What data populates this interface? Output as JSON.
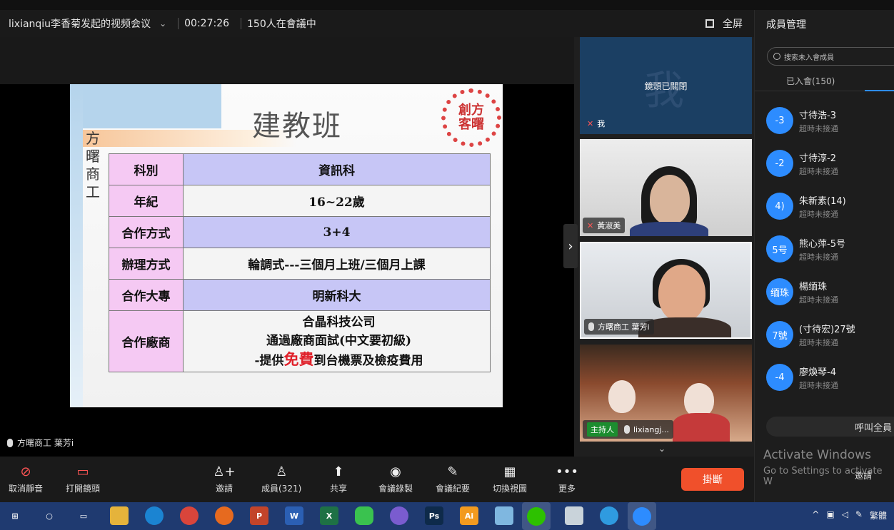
{
  "meeting": {
    "title": "lixianqiu李香菊发起的视频会议",
    "elapsed": "00:27:26",
    "participants_in_meeting": "150人在會議中",
    "fullscreen_label": "全屏"
  },
  "slide": {
    "heading": "建教班",
    "school_vertical": "方曙商工",
    "seal_text": "創方客曙",
    "table": [
      {
        "key": "科別",
        "value": "資訊科"
      },
      {
        "key": "年紀",
        "value": "16~22歲"
      },
      {
        "key": "合作方式",
        "value": "3+4"
      },
      {
        "key": "辦理方式",
        "value": "輪調式---三個月上班/三個月上課"
      },
      {
        "key": "合作大專",
        "value": "明新科大"
      }
    ],
    "vendor": {
      "key": "合作廠商",
      "line1": "合晶科技公司",
      "line2": "通過廠商面試(中文要初級)",
      "line3_pre": "-提供",
      "line3_red": "免費",
      "line3_post": "到台機票及檢疫費用"
    }
  },
  "active_speaker": "方曙商工 葉芳i",
  "tiles": {
    "me_big": "我",
    "me_camera_off": "鏡頭已關閉",
    "me_label": "我",
    "p1_label": "黃淑美",
    "p2_label": "方曙商工 葉芳i",
    "p3_host": "主持人",
    "p3_label": "lixiangj..."
  },
  "panel": {
    "title": "成員管理",
    "search_placeholder": "搜索未入會成員",
    "joined_tab": "已入會(150)",
    "members": [
      {
        "avatar": "-3",
        "name": "寸待浩-3",
        "status": "超時未接通"
      },
      {
        "avatar": "-2",
        "name": "寸待淳-2",
        "status": "超時未接通"
      },
      {
        "avatar": "4)",
        "name": "朱新素(14)",
        "status": "超時未接通"
      },
      {
        "avatar": "5号",
        "name": "熊心萍-5号",
        "status": "超時未接通"
      },
      {
        "avatar": "缅珠",
        "name": "楊缅珠",
        "status": "超時未接通"
      },
      {
        "avatar": "7號",
        "name": "(寸待宏)27號",
        "status": "超時未接通"
      },
      {
        "avatar": "-4",
        "name": "廖煥琴-4",
        "status": "超時未接通"
      }
    ],
    "call_all": "呼叫全員",
    "activate_title": "Activate Windows",
    "activate_sub": "Go to Settings to activate W",
    "invite": "邀請"
  },
  "toolbar": {
    "unmute": "取消靜音",
    "start_video": "打開鏡頭",
    "invite": "邀請",
    "members": "成員(321)",
    "share": "共享",
    "record": "會議錄製",
    "summary": "會議紀要",
    "layout": "切換視圖",
    "more": "更多",
    "hangup": "掛斷"
  },
  "taskbar": {
    "apps": [
      "start-icon",
      "search-icon",
      "task-view-icon",
      "file-explorer-icon",
      "edge-icon",
      "chrome-icon",
      "firefox-icon",
      "powerpoint-icon",
      "word-icon",
      "excel-icon",
      "line-icon",
      "viber-icon",
      "photoshop-icon",
      "illustrator-icon",
      "notes-icon",
      "wechat-icon",
      "paint-icon",
      "zoom-bird-icon",
      "tencent-meeting-icon"
    ],
    "tray_text": "繁體"
  },
  "colors": {
    "accent": "#2d8cff",
    "hangup": "#f0502b",
    "taskbar": "#1f3a70",
    "header_row": "#c7c6f6",
    "key_cell": "#f5c9f3"
  }
}
